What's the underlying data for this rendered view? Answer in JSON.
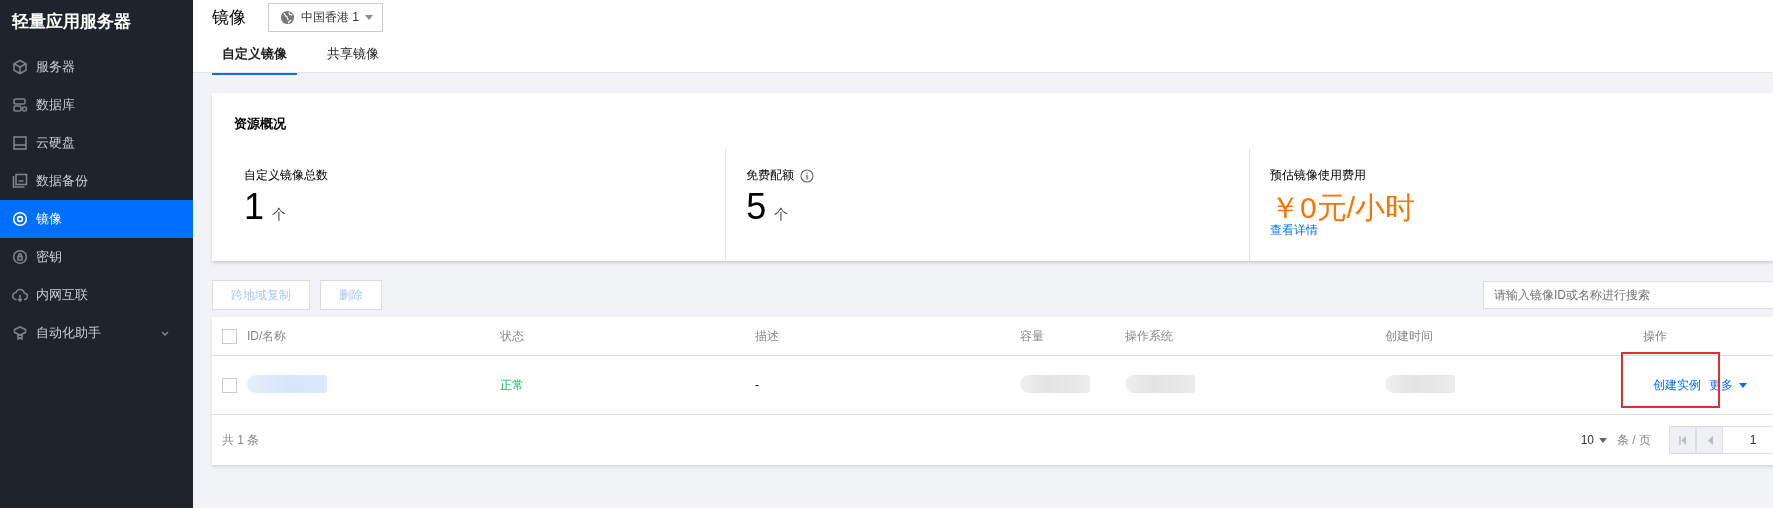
{
  "sidebar": {
    "title": "轻量应用服务器",
    "items": [
      {
        "label": "服务器",
        "selected": false,
        "expandable": false
      },
      {
        "label": "数据库",
        "selected": false,
        "expandable": false
      },
      {
        "label": "云硬盘",
        "selected": false,
        "expandable": false
      },
      {
        "label": "数据备份",
        "selected": false,
        "expandable": false
      },
      {
        "label": "镜像",
        "selected": true,
        "expandable": false
      },
      {
        "label": "密钥",
        "selected": false,
        "expandable": false
      },
      {
        "label": "内网互联",
        "selected": false,
        "expandable": false
      },
      {
        "label": "自动化助手",
        "selected": false,
        "expandable": true
      }
    ]
  },
  "header": {
    "title": "镜像",
    "region": "中国香港 1"
  },
  "tabs": [
    {
      "label": "自定义镜像",
      "selected": true
    },
    {
      "label": "共享镜像",
      "selected": false
    }
  ],
  "overview": {
    "title": "资源概况",
    "stats": [
      {
        "label": "自定义镜像总数",
        "value": "1",
        "unit": "个",
        "kind": "count"
      },
      {
        "label": "免费配额",
        "value": "5",
        "unit": "个",
        "kind": "quota"
      },
      {
        "label": "预估镜像使用费用",
        "value": "￥0元/小时",
        "link": "查看详情",
        "kind": "cost"
      }
    ]
  },
  "toolbar": {
    "buttons": [
      {
        "label": "跨地域复制",
        "disabled": true
      },
      {
        "label": "删除",
        "disabled": true
      }
    ],
    "search": {
      "placeholder": "请输入镜像ID或名称进行搜索"
    }
  },
  "table": {
    "select_all_checked": false,
    "columns": [
      "ID/名称",
      "状态",
      "描述",
      "容量",
      "操作系统",
      "创建时间",
      "操作"
    ],
    "rows": [
      {
        "checked": false,
        "cells": [
          {
            "kind": "blurred"
          },
          {
            "kind": "status",
            "text": "正常"
          },
          {
            "kind": "text",
            "text": "-"
          },
          {
            "kind": "blurred"
          },
          {
            "kind": "blurred"
          },
          {
            "kind": "blurred"
          },
          {
            "kind": "actions",
            "actions": [
              "创建实例",
              "更多"
            ],
            "highlighted": true
          }
        ]
      }
    ],
    "total": "共 1 条",
    "page_size": "10",
    "page_size_unit": "条 / 页",
    "page": "1"
  }
}
